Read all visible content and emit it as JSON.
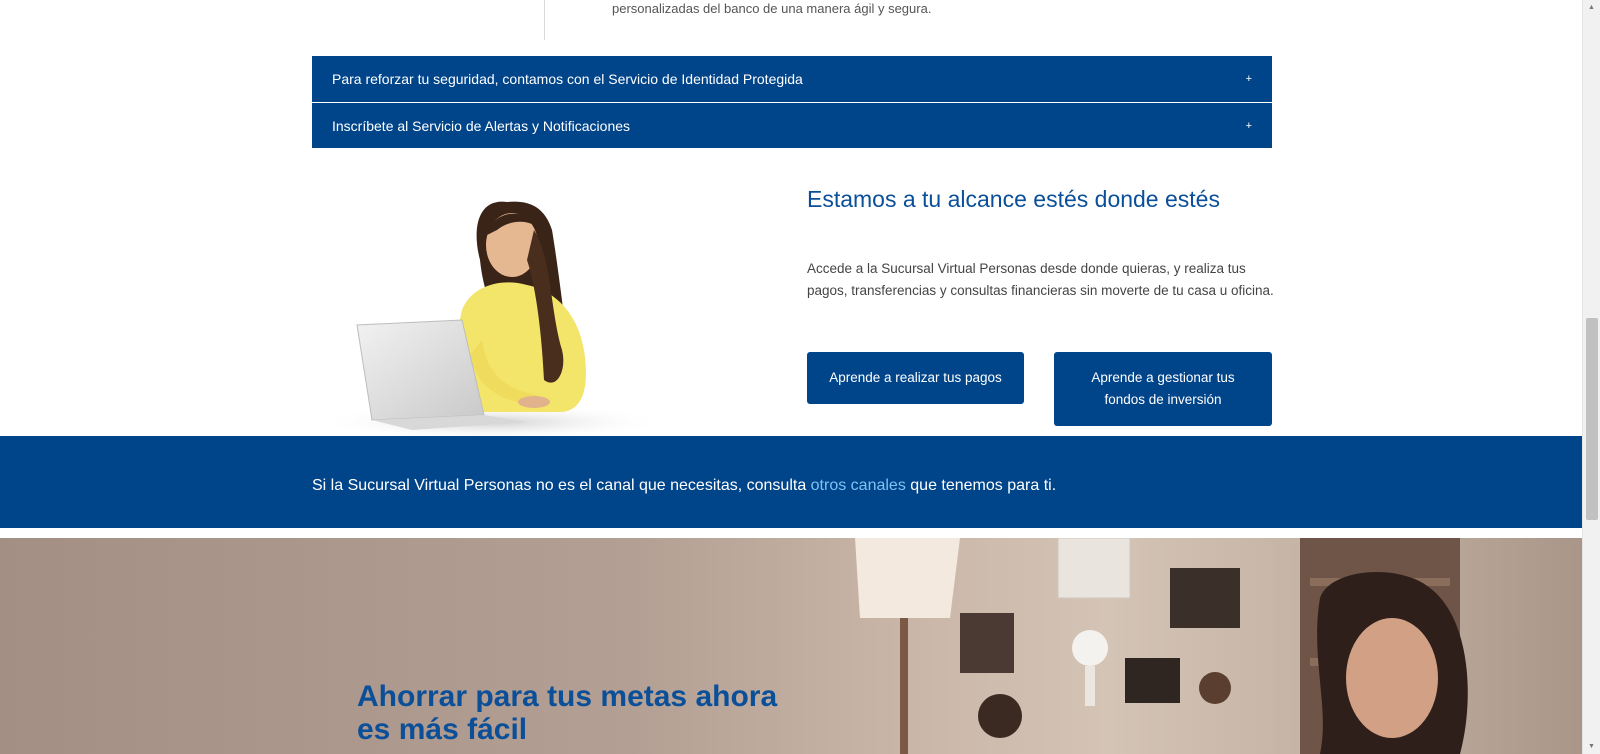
{
  "top": {
    "text": "personalizadas del banco de una manera ágil y segura."
  },
  "accordion": {
    "items": [
      {
        "label": "Para reforzar tu seguridad, contamos con el Servicio de Identidad Protegida",
        "icon": "+"
      },
      {
        "label": "Inscríbete al Servicio de Alertas y Notificaciones",
        "icon": "+"
      }
    ]
  },
  "reach": {
    "title": "Estamos a tu alcance estés donde estés",
    "text": "Accede a la Sucursal Virtual Personas desde donde quieras, y realiza tus pagos, transferencias y consultas financieras sin moverte de tu casa u oficina.",
    "btn_pay": "Aprende a realizar tus pagos",
    "btn_funds": "Aprende a gestionar tus fondos de inversión"
  },
  "banner": {
    "before": "Si la Sucursal Virtual Personas no es el canal que necesitas, consulta ",
    "link": "otros canales",
    "after": " que tenemos para ti."
  },
  "hero": {
    "title": "Ahorrar para tus metas ahora es más fácil"
  },
  "colors": {
    "primary": "#00448a",
    "title_blue": "#0b4f99",
    "link": "#7ec3f3"
  }
}
